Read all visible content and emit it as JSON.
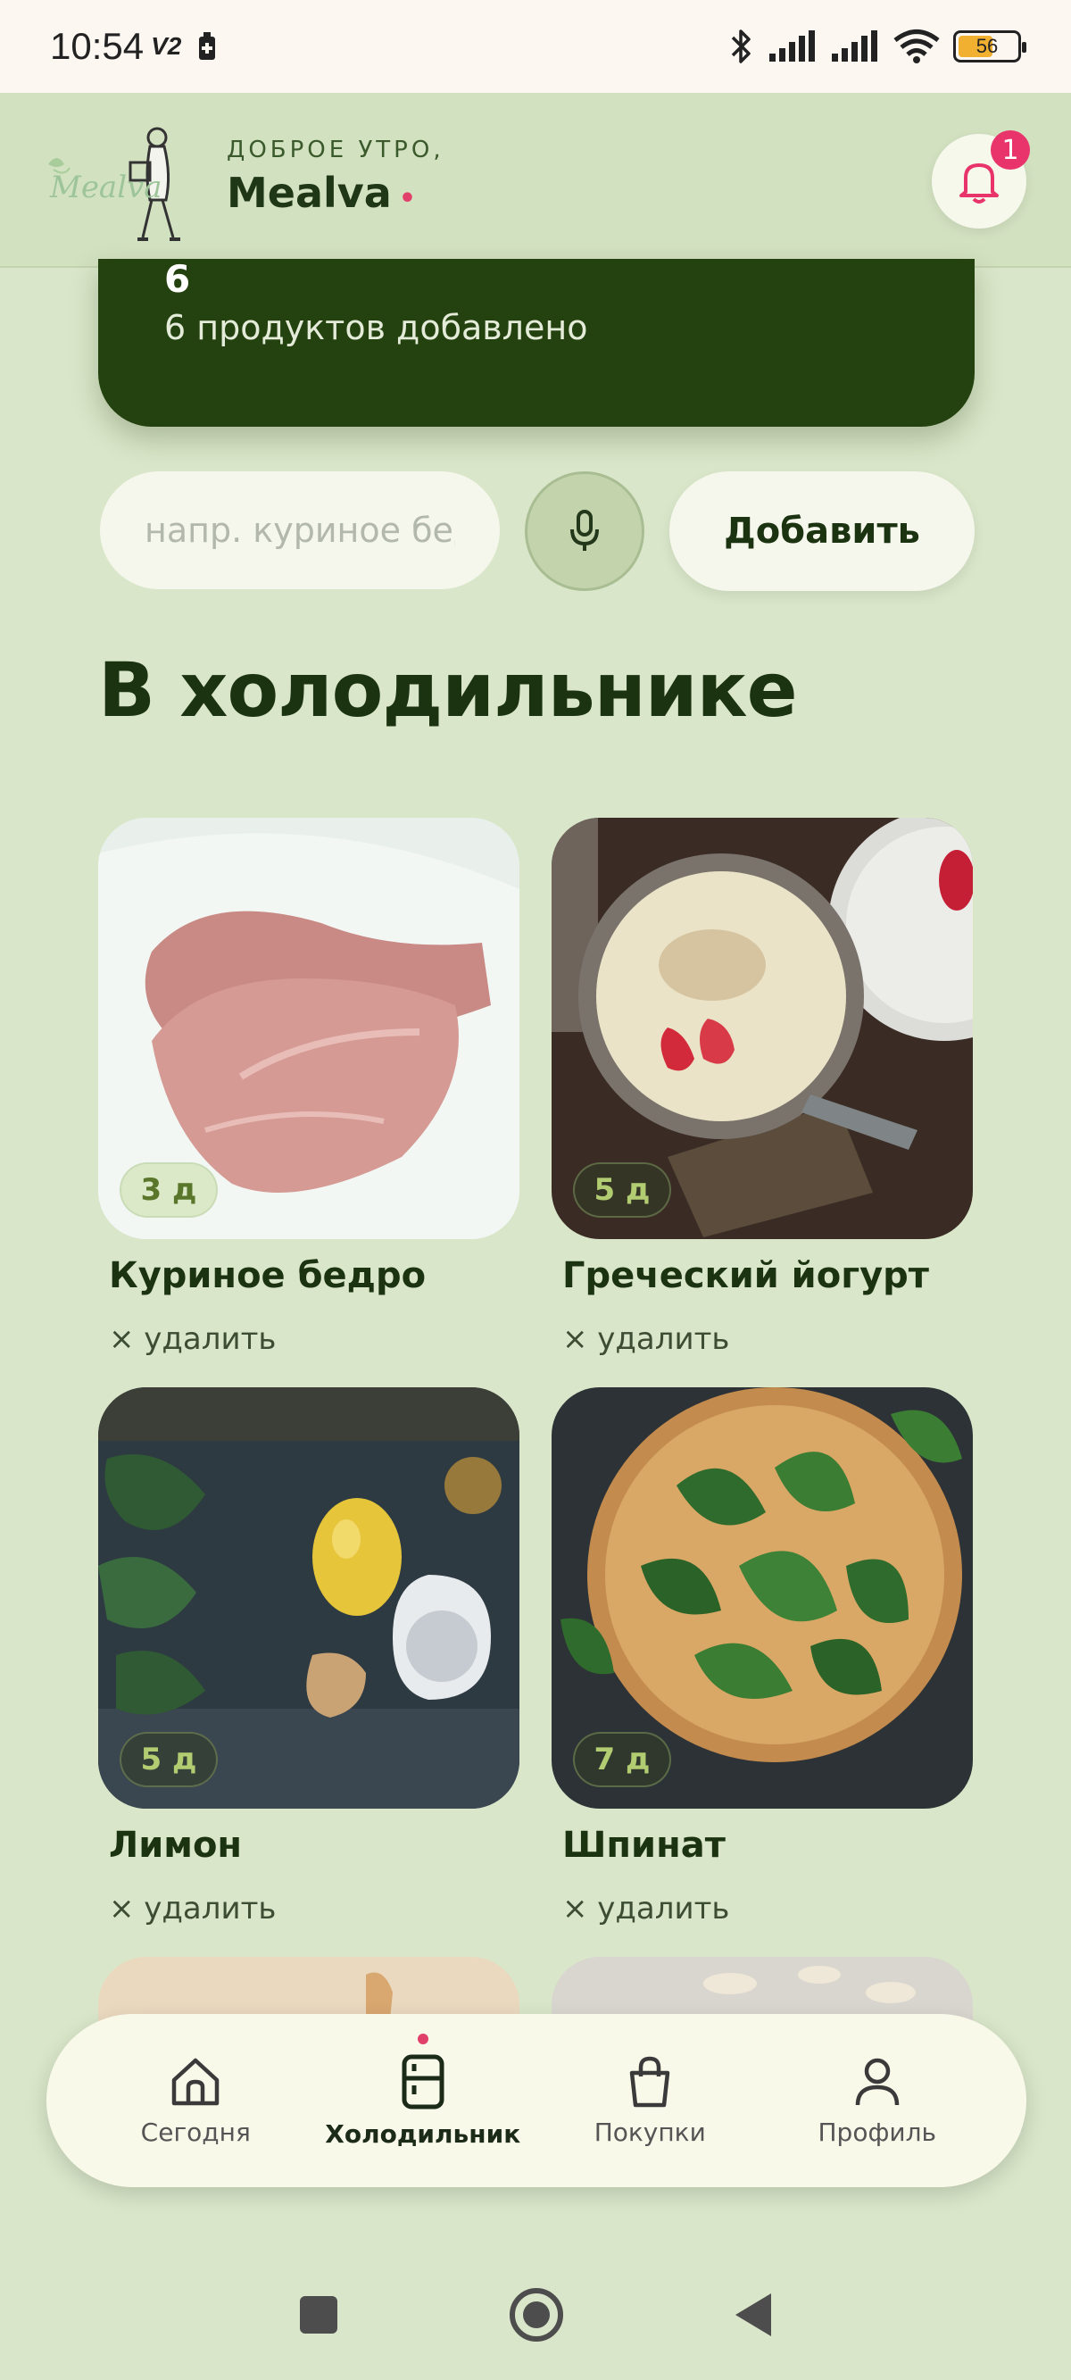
{
  "status_bar": {
    "time": "10:54",
    "network_label": "V2",
    "battery_level": "56"
  },
  "header": {
    "logo_text": "Mealva",
    "greeting": "ДОБРОЕ УТРО,",
    "name": "Mealva",
    "notification_count": "1"
  },
  "summary": {
    "count": "6",
    "text": "6 продуктов добавлено"
  },
  "add_form": {
    "placeholder": "напр. куриное бедро",
    "add_label": "Добавить"
  },
  "section_title": "В холодильнике",
  "items": [
    {
      "name": "Куриное бедро",
      "days": "3 д",
      "remove": "× удалить"
    },
    {
      "name": "Греческий йогурт",
      "days": "5 д",
      "remove": "× удалить"
    },
    {
      "name": "Лимон",
      "days": "5 д",
      "remove": "× удалить"
    },
    {
      "name": "Шпинат",
      "days": "7 д",
      "remove": "× удалить"
    }
  ],
  "nav": {
    "today": "Сегодня",
    "fridge": "Холодильник",
    "shopping": "Покупки",
    "profile": "Профиль"
  },
  "colors": {
    "accent": "#24420f",
    "background": "#d9e6c9",
    "badge": "#e8336b"
  }
}
